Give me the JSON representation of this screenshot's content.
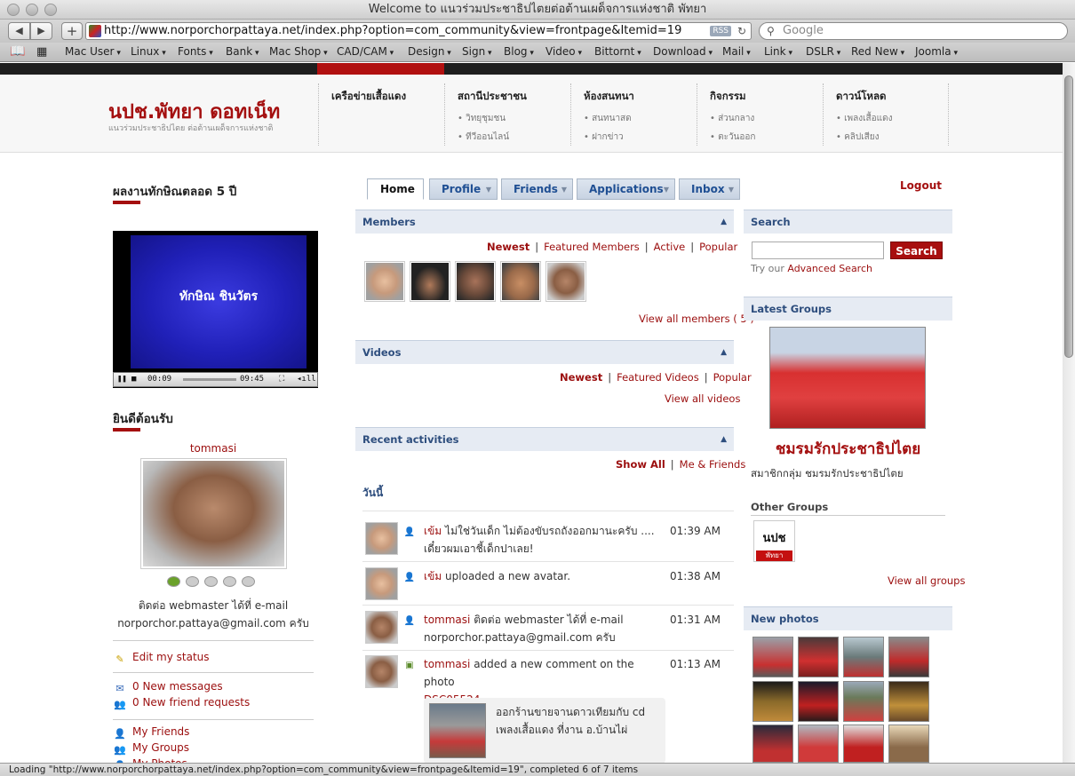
{
  "window": {
    "title": "Welcome to แนวร่วมประชาธิปไตยต่อต้านเผด็จการแห่งชาติ พัทยา"
  },
  "toolbar": {
    "back": "◀",
    "forward": "▶",
    "add": "+",
    "url": "http://www.norporchorpattaya.net/index.php?option=com_community&view=frontpage&Itemid=19",
    "rss": "RSS",
    "reload": "↻",
    "search_placeholder": "Google"
  },
  "bookmarks": {
    "items": [
      "Mac User",
      "Linux",
      "Fonts",
      "Bank",
      "Mac Shop",
      "CAD/CAM",
      "Design",
      "Sign",
      "Blog",
      "Video",
      "Bittornt",
      "Download",
      "Mail",
      "Link",
      "DSLR",
      "Red New",
      "Joomla"
    ]
  },
  "site": {
    "logo": "นปช.พัทยา ดอทเน็ท",
    "logo_sub": "แนวร่วมประชาธิปไตย ต่อต้านเผด็จการแห่งชาติ",
    "nav": [
      {
        "title": "เครือข่ายเสื้อแดง",
        "sub": [
          "",
          ""
        ]
      },
      {
        "title": "สถานีประชาชน",
        "sub": [
          "• วิทยุชุมชน",
          "• ทีวีออนไลน์"
        ]
      },
      {
        "title": "ห้องสนทนา",
        "sub": [
          "• สนทนาสด",
          "• ฝากข่าว"
        ]
      },
      {
        "title": "กิจกรรม",
        "sub": [
          "• ส่วนกลาง",
          "• ตะวันออก"
        ]
      },
      {
        "title": "ดาวน์โหลด",
        "sub": [
          "• เพลงเสื้อแดง",
          "• คลิปเสียง"
        ]
      }
    ]
  },
  "left": {
    "video_heading": "ผลงานทักษิณตลอด 5 ปี",
    "video_title": "ทักษิณ ชินวัตร",
    "video_time_current": "00:09",
    "video_time_total": "09:45",
    "welcome_heading": "ยินดีต้อนรับ",
    "username": "tommasi",
    "status_line1": "ติดต่อ webmaster ได้ที่ e-mail",
    "status_line2": "norporchor.pattaya@gmail.com ครับ",
    "edit_status": "Edit my status",
    "new_messages": "0 New messages",
    "new_friend_requests": "0 New friend requests",
    "my_friends": "My Friends",
    "my_groups": "My Groups",
    "my_photos": "My Photos"
  },
  "tabs": [
    {
      "label": "Home"
    },
    {
      "label": "Profile"
    },
    {
      "label": "Friends"
    },
    {
      "label": "Applications"
    },
    {
      "label": "Inbox"
    }
  ],
  "logout": "Logout",
  "members": {
    "title": "Members",
    "filters": [
      "Newest",
      "Featured Members",
      "Active",
      "Popular"
    ],
    "view_all": "View all members ( 5 )"
  },
  "videos": {
    "title": "Videos",
    "filters": [
      "Newest",
      "Featured Videos",
      "Popular"
    ],
    "view_all": "View all videos"
  },
  "activities": {
    "title": "Recent activities",
    "filters": [
      "Show All",
      "Me & Friends"
    ],
    "today": "วันนี้",
    "items": [
      {
        "name": "เข้ม",
        "text": "ไม่ใช่วันเด็ก ไม่ต้องขับรถถังออกมานะครับ .... เดี๋ยวผมเอาชี้เด็กปาเลย!",
        "time": "01:39 AM"
      },
      {
        "name": "เข้ม",
        "text": "uploaded a new avatar.",
        "time": "01:38 AM"
      },
      {
        "name": "tommasi",
        "text": "ติดต่อ webmaster ได้ที่ e-mail norporchor.pattaya@gmail.com ครับ",
        "time": "01:31 AM"
      },
      {
        "name": "tommasi",
        "text": "added a new comment on the photo",
        "link": "DSC05524",
        "time": "01:13 AM"
      }
    ],
    "comment_text": "ออกร้านขายจานดาวเทียมกับ cd เพลงเสื้อแดง ที่งาน อ.บ้านไผ่"
  },
  "search": {
    "title": "Search",
    "button": "Search",
    "hint": "Try our",
    "advanced": "Advanced Search"
  },
  "groups": {
    "title": "Latest Groups",
    "group_name": "ชมรมรักประชาธิปไตย",
    "group_desc": "สมาชิกกลุ่ม ชมรมรักประชาธิปไตย",
    "other_title": "Other Groups",
    "logo_text_top": "นปช",
    "logo_text_bottom": "พัทยา",
    "view_all": "View all groups"
  },
  "photos": {
    "title": "New photos"
  },
  "statusbar": "Loading \"http://www.norporchorpattaya.net/index.php?option=com_community&view=frontpage&Itemid=19\", completed 6 of 7 items"
}
